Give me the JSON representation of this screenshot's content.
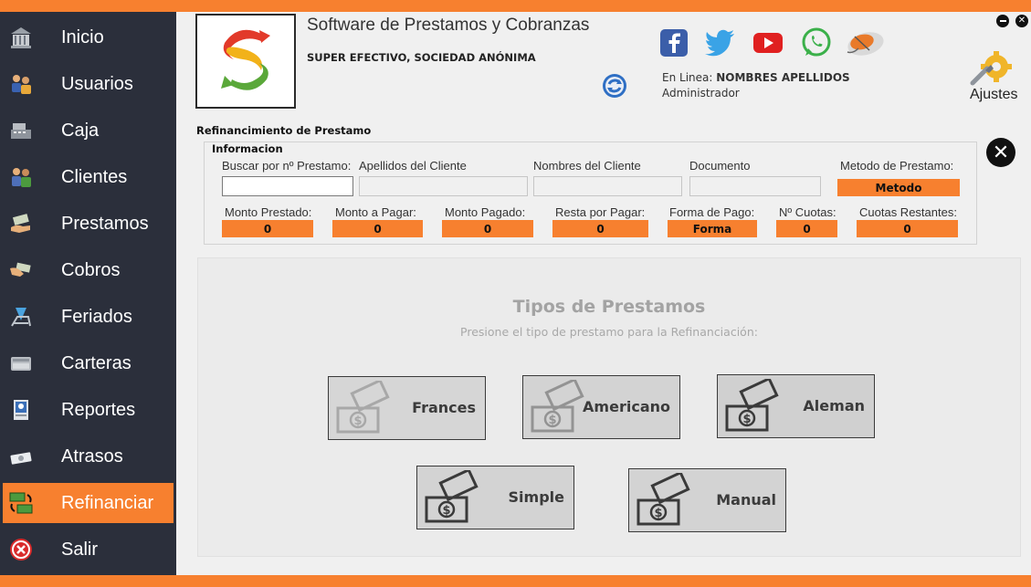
{
  "sidebar": {
    "items": [
      {
        "label": "Inicio",
        "icon": "building-icon"
      },
      {
        "label": "Usuarios",
        "icon": "users-icon"
      },
      {
        "label": "Caja",
        "icon": "cash-register-icon"
      },
      {
        "label": "Clientes",
        "icon": "clients-icon"
      },
      {
        "label": "Prestamos",
        "icon": "loan-hand-icon"
      },
      {
        "label": "Cobros",
        "icon": "payment-hand-icon"
      },
      {
        "label": "Feriados",
        "icon": "beach-chair-icon"
      },
      {
        "label": "Carteras",
        "icon": "wallet-icon"
      },
      {
        "label": "Reportes",
        "icon": "report-icon"
      },
      {
        "label": "Atrasos",
        "icon": "late-money-icon"
      },
      {
        "label": "Refinanciar",
        "icon": "refinance-icon"
      },
      {
        "label": "Salir",
        "icon": "exit-icon"
      }
    ],
    "active": "Refinanciar"
  },
  "header": {
    "app_title": "Software de Prestamos y Cobranzas",
    "company": "SUPER EFECTIVO, SOCIEDAD ANÓNIMA",
    "online_prefix": "En Linea:",
    "online_user": "NOMBRES APELLIDOS",
    "role": "Administrador",
    "settings_label": "Ajustes",
    "social": [
      "facebook-icon",
      "twitter-icon",
      "youtube-icon",
      "whatsapp-icon",
      "mouse-icon"
    ]
  },
  "form": {
    "group_title": "Refinancimiento de Prestamo",
    "info_title": "Informacion",
    "labels": {
      "search": "Buscar por nº Prestamo:",
      "lastnames": "Apellidos del Cliente",
      "names": "Nombres del Cliente",
      "document": "Documento",
      "method": "Metodo de Prestamo:",
      "lent": "Monto Prestado:",
      "to_pay": "Monto a Pagar:",
      "paid": "Monto Pagado:",
      "remaining": "Resta por Pagar:",
      "payment_form": "Forma de Pago:",
      "installments": "Nº Cuotas:",
      "installments_left": "Cuotas Restantes:"
    },
    "values": {
      "method": "Metodo",
      "lent": "0",
      "to_pay": "0",
      "paid": "0",
      "remaining": "0",
      "payment_form": "Forma",
      "installments": "0",
      "installments_left": "0"
    }
  },
  "loan_types": {
    "title": "Tipos de Prestamos",
    "subtitle": "Presione el tipo de prestamo para la Refinanciación:",
    "buttons": [
      "Frances",
      "Americano",
      "Aleman",
      "Simple",
      "Manual"
    ]
  },
  "colors": {
    "accent": "#f7802f",
    "sidebar": "#2b2f3b"
  }
}
